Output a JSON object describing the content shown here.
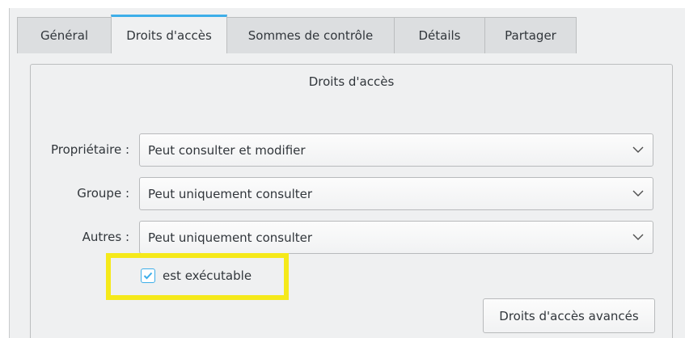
{
  "tabs": [
    {
      "label": "Général",
      "active": false
    },
    {
      "label": "Droits d'accès",
      "active": true
    },
    {
      "label": "Sommes de contrôle",
      "active": false
    },
    {
      "label": "Détails",
      "active": false
    },
    {
      "label": "Partager",
      "active": false
    }
  ],
  "panel": {
    "title": "Droits d'accès",
    "rows": [
      {
        "label": "Propriétaire :",
        "value": "Peut consulter et modifier"
      },
      {
        "label": "Groupe :",
        "value": "Peut uniquement consulter"
      },
      {
        "label": "Autres :",
        "value": "Peut uniquement consulter"
      }
    ],
    "executable": {
      "label": "est exécutable",
      "checked": true
    },
    "advanced_button": "Droits d'accès avancés"
  },
  "colors": {
    "accent": "#3daee9",
    "highlight": "#f5e91a",
    "background": "#eff0f1"
  }
}
